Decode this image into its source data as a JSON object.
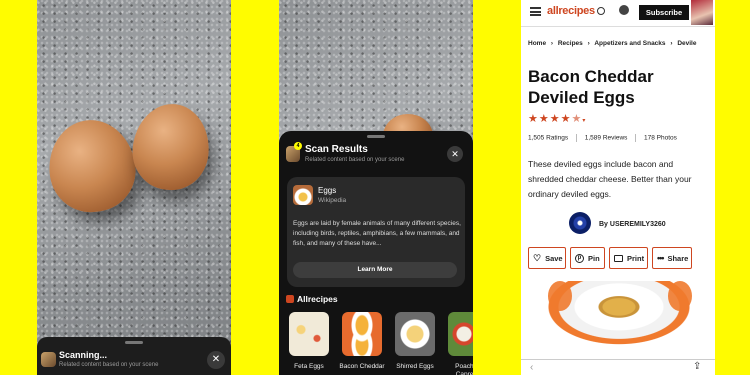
{
  "scanning_screen": {
    "title": "Scanning...",
    "subtitle": "Related content based on your scene",
    "close": "✕"
  },
  "scan_results": {
    "title": "Scan Results",
    "subtitle": "Related content based on your scene",
    "badge": "4",
    "close": "✕",
    "wiki_card": {
      "title": "Eggs",
      "source": "Wikipedia",
      "description": "Eggs are laid by female animals of many different species, including birds, reptiles, amphibians, a few mammals, and fish, and many of these have...",
      "button": "Learn More"
    },
    "section_title": "Allrecipes",
    "recipes": [
      {
        "label": "Feta Eggs"
      },
      {
        "label": "Bacon Cheddar"
      },
      {
        "label": "Shirred Eggs"
      },
      {
        "label": "Poached Caprese"
      }
    ]
  },
  "allrecipes": {
    "logo": "allrecipes",
    "subscribe": "Subscribe",
    "breadcrumb": [
      "Home",
      "Recipes",
      "Appetizers and Snacks",
      "Devile"
    ],
    "title": "Bacon Cheddar Deviled Eggs",
    "rating_stars": 4.5,
    "ratings": "1,505 Ratings",
    "reviews": "1,589 Reviews",
    "photos": "178 Photos",
    "description": "These deviled eggs include bacon and shredded cheddar cheese. Better than your ordinary deviled eggs.",
    "author": "By USEREMILY3260",
    "actions": {
      "save": "Save",
      "pin": "Pin",
      "print": "Print",
      "share": "Share"
    },
    "brand_color": "#ce4620"
  }
}
